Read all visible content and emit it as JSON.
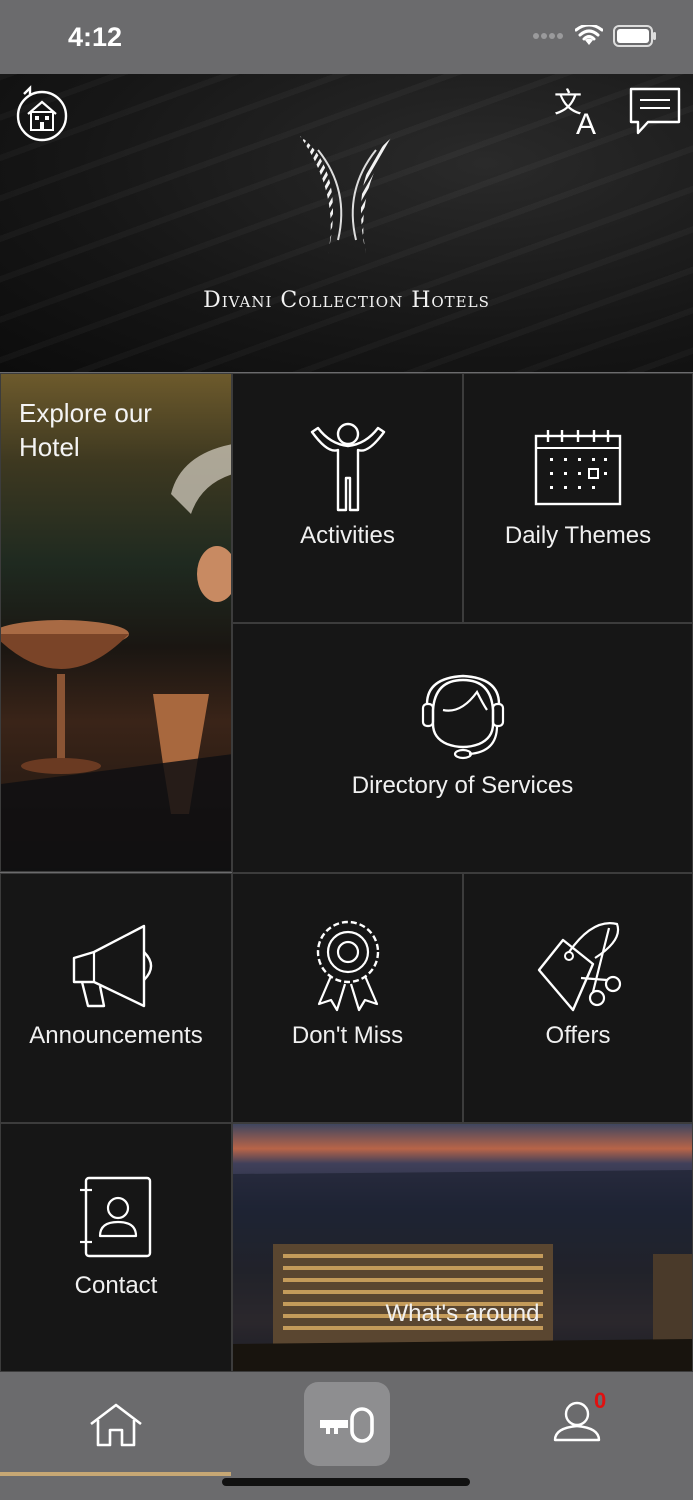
{
  "status_bar": {
    "time": "4:12"
  },
  "header": {
    "brand_name": "Divani Collection Hotels",
    "icons": [
      "hotel-switch-icon",
      "translate-icon",
      "chat-icon"
    ]
  },
  "tiles": {
    "explore": {
      "label": "Explore our Hotel"
    },
    "activities": {
      "label": "Activities",
      "icon": "person-icon"
    },
    "daily_themes": {
      "label": "Daily Themes",
      "icon": "calendar-icon"
    },
    "directory": {
      "label": "Directory of Services",
      "icon": "headset-icon"
    },
    "announcements": {
      "label": "Announcements",
      "icon": "megaphone-icon"
    },
    "dont_miss": {
      "label": "Don't Miss",
      "icon": "award-ribbon-icon"
    },
    "offers": {
      "label": "Offers",
      "icon": "price-tag-icon"
    },
    "contact": {
      "label": "Contact",
      "icon": "contact-book-icon"
    },
    "whats_around": {
      "label": "What's around"
    }
  },
  "bottom_nav": {
    "items": [
      "home-icon",
      "key-icon",
      "profile-icon"
    ],
    "notification_count": "0",
    "accent_color": "#c6a774"
  }
}
